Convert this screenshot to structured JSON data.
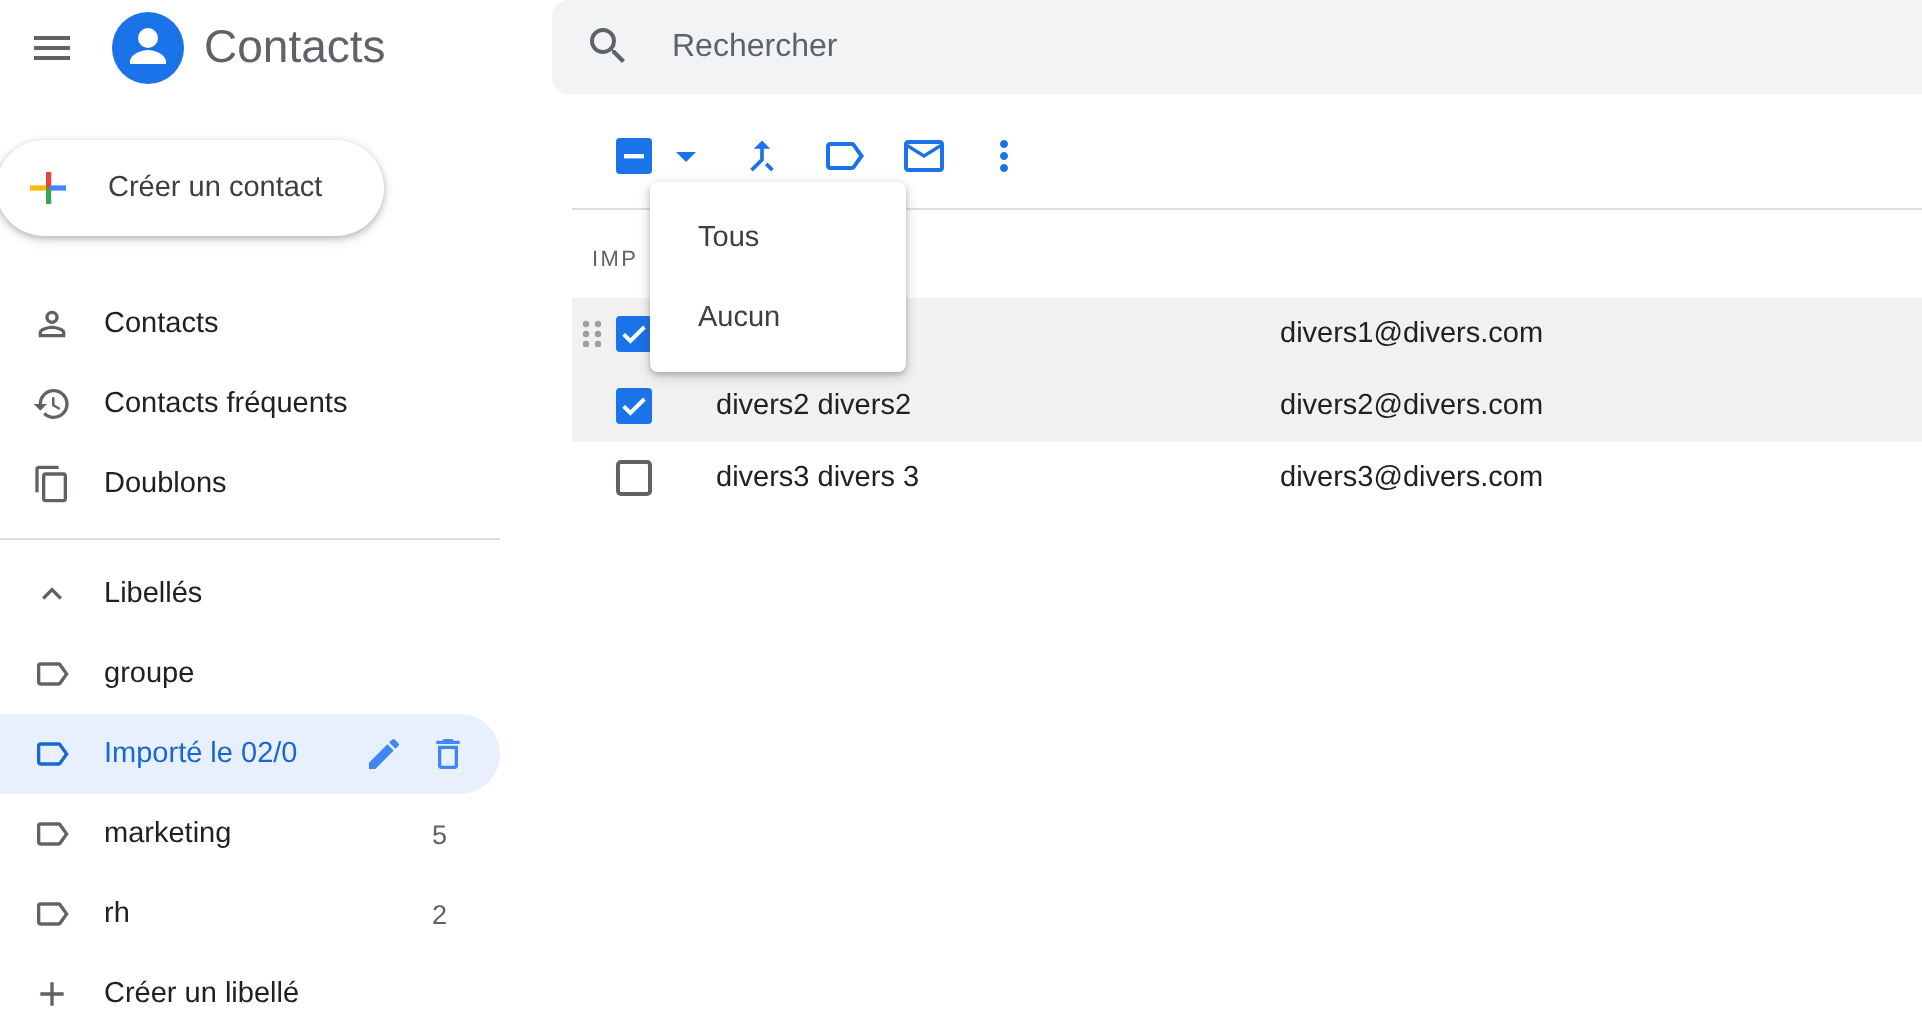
{
  "app": {
    "title": "Contacts"
  },
  "search": {
    "placeholder": "Rechercher"
  },
  "create_button": {
    "label": "Créer un contact"
  },
  "nav": [
    {
      "kind": "person",
      "label": "Contacts"
    },
    {
      "kind": "history",
      "label": "Contacts fréquents"
    },
    {
      "kind": "duplicates",
      "label": "Doublons"
    }
  ],
  "labels": {
    "title": "Libellés",
    "expanded": true,
    "items": [
      {
        "name": "groupe",
        "selected": false
      },
      {
        "name": "Importé le 02/0",
        "selected": true
      },
      {
        "name": "marketing",
        "count": "5",
        "selected": false
      },
      {
        "name": "rh",
        "count": "2",
        "selected": false
      }
    ],
    "create": "Créer un libellé"
  },
  "toolbar": {
    "partially_selected": true
  },
  "select_menu": {
    "items": [
      "Tous",
      "Aucun"
    ]
  },
  "list": {
    "section": "IMP",
    "rows": [
      {
        "email": "divers1@divers.com",
        "checked": true,
        "hovered": true
      },
      {
        "name": "divers2 divers2",
        "email": "divers2@divers.com",
        "checked": true,
        "hovered": false
      },
      {
        "name": "divers3 divers 3",
        "email": "divers3@divers.com",
        "checked": false,
        "hovered": false
      }
    ]
  }
}
